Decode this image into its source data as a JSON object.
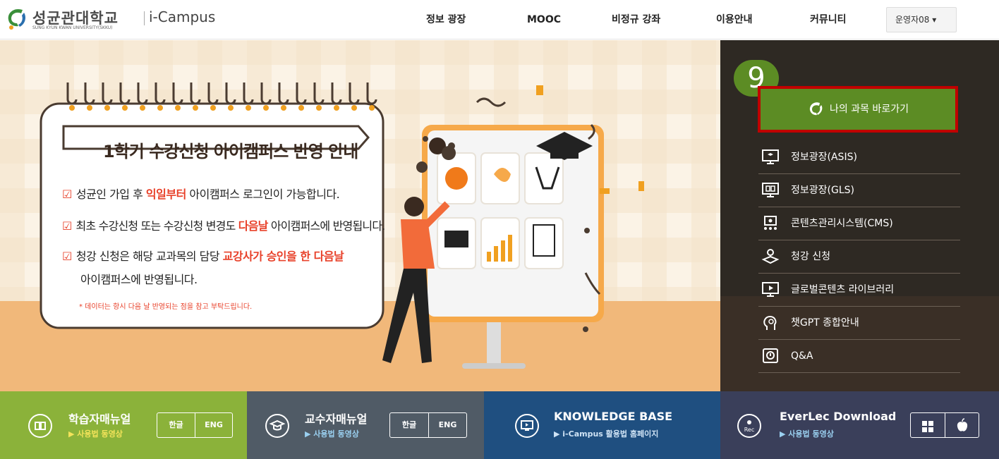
{
  "header": {
    "logo_korean": "성균관대학교",
    "logo_english": "SUNG KYUN KWAN UNIVERSITY(SKKU)",
    "logo_product": "i-Campus",
    "nav": [
      "정보 광장",
      "MOOC",
      "비정규 강좌",
      "이용안내",
      "커뮤니티"
    ],
    "user_menu": "운영자08 ▾"
  },
  "hero": {
    "title": "1학기 수강신청 아이캠퍼스 반영 안내",
    "items": [
      {
        "pre": "성균인 가입 후 ",
        "hl": "익일부터",
        "post": " 아이캠퍼스 로그인이 가능합니다."
      },
      {
        "pre": "최초 수강신청 또는 수강신청 변경도 ",
        "hl": "다음날",
        "post": " 아이캠퍼스에 반영됩니다."
      },
      {
        "pre": "청강 신청은 해당 교과목의 담당 ",
        "hl": "교강사가 승인을 한 다음날",
        "post": ""
      }
    ],
    "item3_line2": "아이캠퍼스에 반영됩니다.",
    "note": "* 데이터는 항시 다음 날 반영되는 점을 참고 부탁드립니다.",
    "check_mark": "☑",
    "colors": {
      "highlight": "#e8412a",
      "bg": "#f7ecd9",
      "floor": "#f1b87a"
    }
  },
  "annotation": {
    "badge": "9"
  },
  "quick": {
    "goto_label": "나의 과목 바로가기",
    "menu": [
      {
        "label": "정보광장(ASIS)",
        "icon": "monitor-graduate-icon"
      },
      {
        "label": "정보광장(GLS)",
        "icon": "monitor-book-icon"
      },
      {
        "label": "콘텐츠관리시스템(CMS)",
        "icon": "monitor-people-icon"
      },
      {
        "label": "청강 신청",
        "icon": "student-book-icon"
      },
      {
        "label": "글로벌콘텐츠 라이브러리",
        "icon": "monitor-play-icon"
      },
      {
        "label": "챗GPT 종합안내",
        "icon": "ai-head-icon"
      },
      {
        "label": "Q&A",
        "icon": "qna-icon"
      }
    ],
    "colors": {
      "green": "#5c8c24",
      "red_frame": "#c00000",
      "panel": "#2e2923"
    }
  },
  "bottom": {
    "learner": {
      "title": "학습자매뉴얼",
      "sub": "▶ 사용법 동영상",
      "btn_ko": "한글",
      "btn_en": "ENG",
      "color": "#8bb23a"
    },
    "professor": {
      "title": "교수자매뉴얼",
      "sub": "▶ 사용법 동영상",
      "btn_ko": "한글",
      "btn_en": "ENG",
      "color": "#505b66"
    },
    "kb": {
      "title": "KNOWLEDGE BASE",
      "sub": "▶ i-Campus 활용법 홈페이지",
      "color": "#1f4f80"
    },
    "everlec": {
      "title": "EverLec Download",
      "sub": "▶ 사용법 동영상",
      "icon_label": "Rec",
      "color": "#3a3f5a"
    }
  }
}
